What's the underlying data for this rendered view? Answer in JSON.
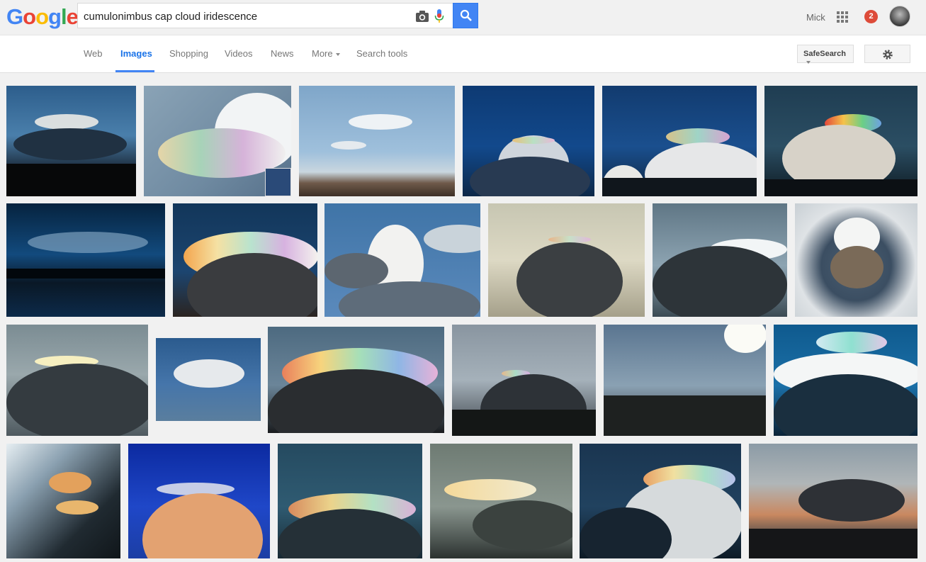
{
  "header": {
    "logo": {
      "letters": [
        "G",
        "o",
        "o",
        "g",
        "l",
        "e"
      ],
      "colors": [
        "#4285f4",
        "#ea4335",
        "#fbbc05",
        "#4285f4",
        "#34a853",
        "#ea4335"
      ]
    },
    "search": {
      "query": "cumulonimbus cap cloud iridescence"
    },
    "icons": {
      "camera": "camera-icon",
      "mic": "microphone-icon",
      "search": "search-icon",
      "apps": "apps-grid-icon"
    },
    "user": {
      "name": "Mick",
      "notifications": "2"
    }
  },
  "tabs": [
    {
      "label": "Web"
    },
    {
      "label": "Images",
      "active": true
    },
    {
      "label": "Shopping"
    },
    {
      "label": "Videos"
    },
    {
      "label": "News"
    },
    {
      "label": "More"
    },
    {
      "label": "Search tools"
    }
  ],
  "tools": {
    "safesearch": "SafeSearch",
    "settings_icon": "gear-icon"
  },
  "results": {
    "image_count": 24,
    "accent": "#4285f4"
  }
}
